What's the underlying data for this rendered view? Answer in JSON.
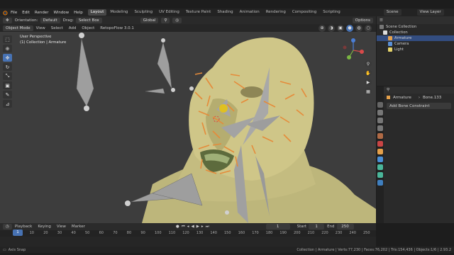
{
  "menubar": {
    "menus": [
      "File",
      "Edit",
      "Render",
      "Window",
      "Help"
    ],
    "workspaces": [
      "Layout",
      "Modeling",
      "Sculpting",
      "UV Editing",
      "Texture Paint",
      "Shading",
      "Animation",
      "Rendering",
      "Compositing",
      "Scripting"
    ],
    "active_workspace": "Layout",
    "scene": "Scene",
    "view_layer": "View Layer"
  },
  "tool_header": {
    "orientation_label": "Orientation:",
    "orientation_value": "Default",
    "drag_label": "Drag:",
    "drag_value": "Select Box",
    "transform_value": "Global",
    "options": "Options"
  },
  "viewport_header": {
    "mode": "Object Mode",
    "menus": [
      "View",
      "Select",
      "Add",
      "Object"
    ],
    "addon": "RetopoFlow 3.0.1"
  },
  "viewport": {
    "view_name": "User Perspective",
    "collection_path": "(1) Collection | Armature"
  },
  "outliner": {
    "root": "Scene Collection",
    "collection": "Collection",
    "items": [
      "Armature",
      "Camera",
      "Light"
    ],
    "selected": "Armature"
  },
  "properties": {
    "object": "Armature",
    "bone": "Bone.133",
    "add_constraint": "Add Bone Constraint"
  },
  "timeline": {
    "menus": [
      "Playback",
      "Keying",
      "View",
      "Marker"
    ],
    "current_frame": "1",
    "start_label": "Start",
    "start": "1",
    "end_label": "End",
    "end": "250",
    "ruler": [
      "1",
      "10",
      "20",
      "30",
      "40",
      "50",
      "60",
      "70",
      "80",
      "90",
      "100",
      "110",
      "120",
      "130",
      "140",
      "150",
      "160",
      "170",
      "180",
      "190",
      "200",
      "210",
      "220",
      "230",
      "240",
      "250"
    ]
  },
  "status": {
    "left": "Axis Snap",
    "right": "Collection | Armature | Verts:77,230 | Faces:76,202 | Tris:154,436 | Objects:1/6 | 2.93.2"
  },
  "colors": {
    "accent": "#4772b3",
    "skin": "#c9c186",
    "bone": "#a9a9a9",
    "bone_selected": "#e58b3a"
  }
}
